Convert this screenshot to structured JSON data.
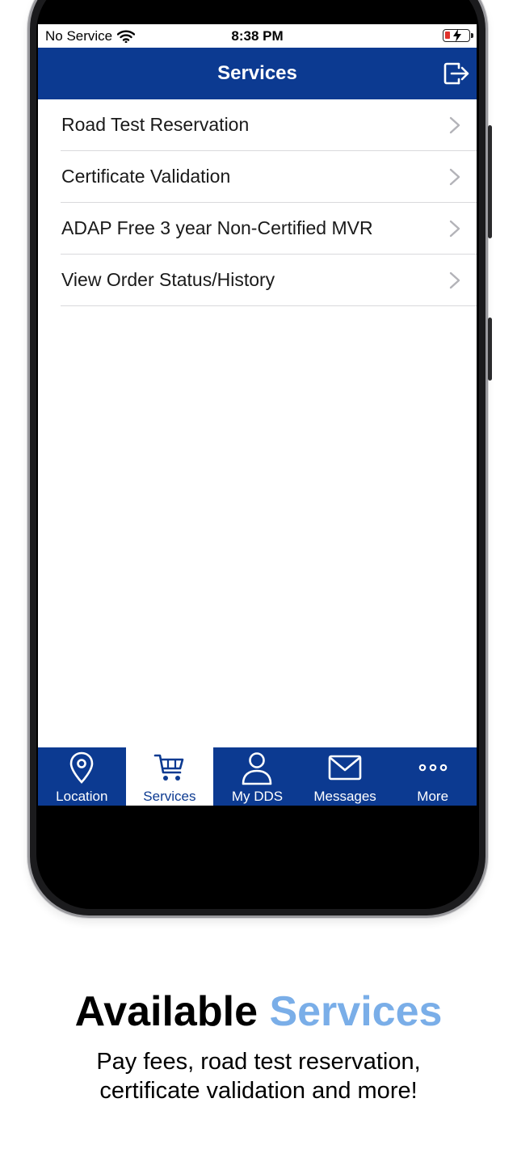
{
  "status_bar": {
    "carrier": "No Service",
    "time": "8:38 PM",
    "battery_color": "#e0322c"
  },
  "header": {
    "title": "Services",
    "logout_icon": "logout-icon",
    "background": "#0c3a91"
  },
  "services": [
    {
      "label": "Road Test Reservation"
    },
    {
      "label": "Certificate Validation"
    },
    {
      "label": "ADAP Free 3 year Non-Certified MVR"
    },
    {
      "label": "View Order Status/History"
    }
  ],
  "tab_bar": {
    "tabs": [
      {
        "label": "Location",
        "icon": "location-pin-icon",
        "active": false
      },
      {
        "label": "Services",
        "icon": "shopping-cart-icon",
        "active": true
      },
      {
        "label": "My DDS",
        "icon": "user-icon",
        "active": false
      },
      {
        "label": "Messages",
        "icon": "envelope-icon",
        "active": false
      },
      {
        "label": "More",
        "icon": "more-dots-icon",
        "active": false
      }
    ]
  },
  "promo": {
    "title_part1": "Available",
    "title_part2": "Services",
    "accent_color": "#7aaee8",
    "subtitle_line1": "Pay fees, road test reservation,",
    "subtitle_line2": "certificate validation and more!"
  }
}
